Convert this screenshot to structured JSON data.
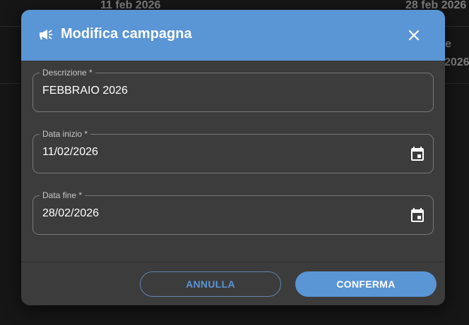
{
  "background": {
    "row1_left": "11 feb 2026",
    "row1_right": "28 feb 2026",
    "row2_right_top": "e",
    "row2_right_bottom": "2026"
  },
  "dialog": {
    "title": "Modifica campagna",
    "header_icon": "megaphone-icon",
    "close_icon": "close-icon",
    "header_color": "#5a95d5"
  },
  "fields": {
    "descrizione": {
      "label": "Descrizione *",
      "value": "FEBBRAIO 2026"
    },
    "data_inizio": {
      "label": "Data inizio *",
      "value": "11/02/2026",
      "icon": "calendar-icon"
    },
    "data_fine": {
      "label": "Data fine *",
      "value": "28/02/2026",
      "icon": "calendar-icon"
    }
  },
  "footer": {
    "cancel_label": "ANNULLA",
    "confirm_label": "CONFERMA"
  }
}
